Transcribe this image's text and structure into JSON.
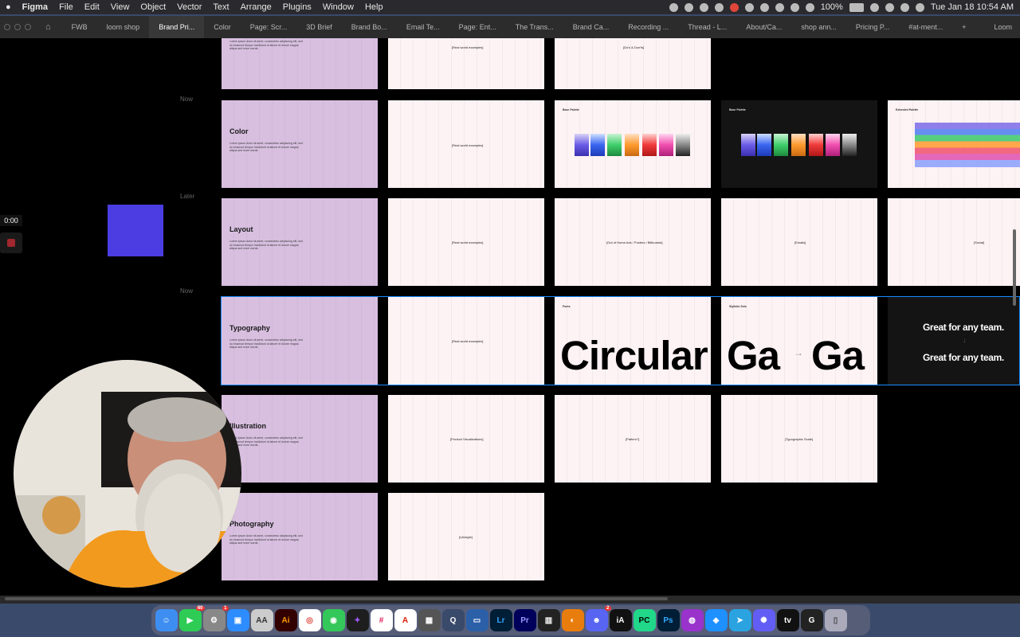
{
  "menubar": {
    "apple": "",
    "items": [
      "Figma",
      "File",
      "Edit",
      "View",
      "Object",
      "Vector",
      "Text",
      "Arrange",
      "Plugins",
      "Window",
      "Help"
    ],
    "battery": "100%",
    "datetime": "Tue Jan 18  10:54 AM"
  },
  "tabs": {
    "items": [
      "FWB",
      "loom shop",
      "Brand Pri...",
      "Color",
      "Page: Scr...",
      "3D Brief",
      "Brand Bo...",
      "Email Te...",
      "Page: Ent...",
      "The Trans...",
      "Brand Ca...",
      "Recording ...",
      "Thread - L...",
      "About/Ca...",
      "shop ann...",
      "Pricing P...",
      "#at-ment..."
    ],
    "plus": "+",
    "right": "Loom"
  },
  "recorder": {
    "time": "0:00"
  },
  "canvas": {
    "row_labels": [
      "Now",
      "Later",
      "Now"
    ],
    "sections": [
      "Color",
      "Layout",
      "Typography",
      "Illustration",
      "Photography"
    ],
    "lorem": "Lorem ipsum dolor sit amet, consectetur adipiscing elit, sed do eiusmod tempor incididunt ut labore et dolore magna aliqua and more words.",
    "placeholders": {
      "real_world": "[Real world examples]",
      "dos_donts": "[Do's & Don'ts]",
      "out_of_home": "[Out of Home Ads / Posters / Billboards]",
      "emails": "[Emails]",
      "social": "[Social]",
      "product_vis": "[Product Visualizations]",
      "pattern": "[Pattern?]",
      "type_scale": "[Typographic Scale]",
      "lifestyle": "[Lifestyle]"
    },
    "base_palette": "Base Palette",
    "extended_palette": "Extended Palette",
    "fonts_label": "Fonts",
    "circular": "Circular",
    "stylistic_sets": "Stylistic Sets",
    "ga_left": "Ga",
    "ga_arrow": "→",
    "ga_right": "Ga",
    "great_team": "Great for any team.",
    "great_arrow": "↓",
    "great_team2": "Great for any team."
  },
  "colors": {
    "purple_frame": "#d8bfe0",
    "pink_frame": "#fdf2f4",
    "selection": "#1a8cff",
    "loom_square": "#4b3de2"
  },
  "dock": {
    "apps": [
      "Finder",
      "FaceTime",
      "System Preferences",
      "Zoom",
      "Font Book",
      "Illustrator",
      "Chrome",
      "Messages",
      "Figma",
      "Slack",
      "Acrobat",
      "Calculator",
      "QuickTime",
      "Screen",
      "Lightroom",
      "Premiere",
      "Piano",
      "Blender",
      "Discord",
      "iA Writer",
      "PyCharm",
      "Photoshop",
      "Podcasts",
      "Safari",
      "Telegram",
      "Loom",
      "Apple TV",
      "Logi",
      "Trash"
    ],
    "badges": {
      "facetime": "60",
      "sysprefs": "1",
      "discord": "2"
    }
  }
}
